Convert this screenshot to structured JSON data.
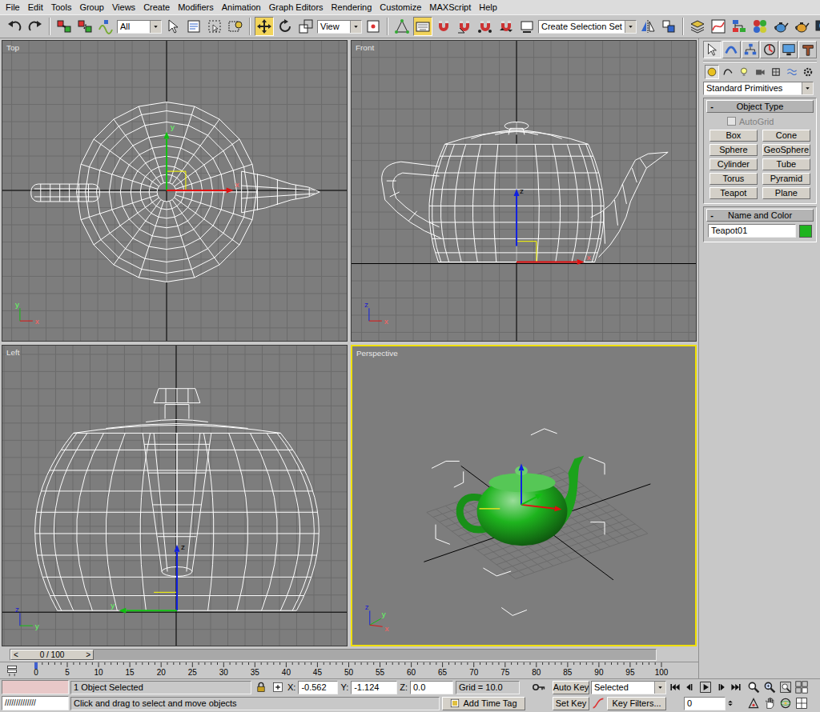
{
  "menu": [
    "File",
    "Edit",
    "Tools",
    "Group",
    "Views",
    "Create",
    "Modifiers",
    "Animation",
    "Graph Editors",
    "Rendering",
    "Customize",
    "MAXScript",
    "Help"
  ],
  "toolbar": {
    "items": [
      {
        "kind": "icon",
        "selected": false
      },
      {
        "kind": "icon",
        "selected": false
      },
      {
        "kind": "separator"
      },
      {
        "kind": "icon",
        "selected": false
      },
      {
        "kind": "icon",
        "selected": false
      },
      {
        "kind": "icon",
        "selected": false
      },
      {
        "kind": "dropdown",
        "value": "All"
      },
      {
        "kind": "icon",
        "selected": false
      },
      {
        "kind": "icon",
        "selected": false
      },
      {
        "kind": "icon",
        "selected": false
      },
      {
        "kind": "icon",
        "selected": false
      },
      {
        "kind": "separator"
      },
      {
        "kind": "icon",
        "selected": true
      },
      {
        "kind": "icon",
        "selected": false
      },
      {
        "kind": "icon",
        "selected": false
      },
      {
        "kind": "dropdown",
        "value": "View"
      },
      {
        "kind": "icon",
        "selected": false
      },
      {
        "kind": "separator"
      },
      {
        "kind": "icon",
        "selected": false
      },
      {
        "kind": "icon",
        "selected": true
      },
      {
        "kind": "icon",
        "selected": false
      },
      {
        "kind": "icon",
        "selected": false
      },
      {
        "kind": "icon",
        "selected": false
      },
      {
        "kind": "icon",
        "selected": false
      },
      {
        "kind": "icon",
        "selected": false
      },
      {
        "kind": "dropdown",
        "value": "Create Selection Set"
      },
      {
        "kind": "icon",
        "selected": false
      },
      {
        "kind": "icon",
        "selected": false
      },
      {
        "kind": "separator"
      },
      {
        "kind": "icon",
        "selected": false
      },
      {
        "kind": "icon",
        "selected": false
      },
      {
        "kind": "icon",
        "selected": false
      },
      {
        "kind": "icon",
        "selected": false
      },
      {
        "kind": "icon",
        "selected": false
      },
      {
        "kind": "icon",
        "selected": false
      },
      {
        "kind": "icon",
        "selected": false
      }
    ]
  },
  "viewports": [
    {
      "label": "Top",
      "active": false,
      "triad": [
        "y",
        "x"
      ],
      "gizmo": [
        "y",
        "x"
      ]
    },
    {
      "label": "Front",
      "active": false,
      "triad": [
        "z",
        "x"
      ],
      "gizmo": [
        "z",
        "x"
      ]
    },
    {
      "label": "Left",
      "active": false,
      "triad": [
        "z",
        "y"
      ],
      "gizmo": [
        "z",
        "y"
      ]
    },
    {
      "label": "Perspective",
      "active": true,
      "triad": [
        "z",
        "y",
        "x"
      ],
      "gizmo": []
    }
  ],
  "command_panel": {
    "tabs": [
      {
        "selected": true
      },
      {
        "selected": false
      },
      {
        "selected": false
      },
      {
        "selected": false
      },
      {
        "selected": false
      },
      {
        "selected": false
      }
    ],
    "categories": [
      {
        "selected": true
      },
      {
        "selected": false
      },
      {
        "selected": false
      },
      {
        "selected": false
      },
      {
        "selected": false
      },
      {
        "selected": false
      },
      {
        "selected": false
      }
    ],
    "dropdown": "Standard Primitives",
    "rollouts": [
      {
        "toggle": "-",
        "title": "Object Type"
      },
      {
        "toggle": "-",
        "title": "Name and Color"
      }
    ],
    "autogrid": {
      "label": "AutoGrid",
      "checked": false,
      "disabled": true
    },
    "buttons": [
      "Box",
      "Cone",
      "Sphere",
      "GeoSphere",
      "Cylinder",
      "Tube",
      "Torus",
      "Pyramid",
      "Teapot",
      "Plane"
    ],
    "object_name": "Teapot01",
    "object_color": "#1eb41e"
  },
  "time_slider": {
    "prev": "<",
    "position": "0 / 100",
    "next": ">",
    "level": 0
  },
  "trackbar": {
    "ticks": [
      "0",
      "5",
      "10",
      "15",
      "20",
      "25",
      "30",
      "35",
      "40",
      "45",
      "50",
      "55",
      "60",
      "65",
      "70",
      "75",
      "80",
      "85",
      "90",
      "95",
      "100"
    ]
  },
  "status": {
    "listener": "//////////////",
    "selection": "1 Object Selected",
    "prompt": "Click and drag to select and move objects",
    "coords": [
      {
        "axis": "X:",
        "value": "-0.562"
      },
      {
        "axis": "Y:",
        "value": "-1.124"
      },
      {
        "axis": "Z:",
        "value": "0.0"
      }
    ],
    "grid": "Grid = 10.0",
    "add_time_tag": "Add Time Tag",
    "auto_key": {
      "label": "Auto Key",
      "on": false
    },
    "set_key": "Set Key",
    "key_mode": "Selected",
    "key_filters": "Key Filters...",
    "frame": "0"
  }
}
